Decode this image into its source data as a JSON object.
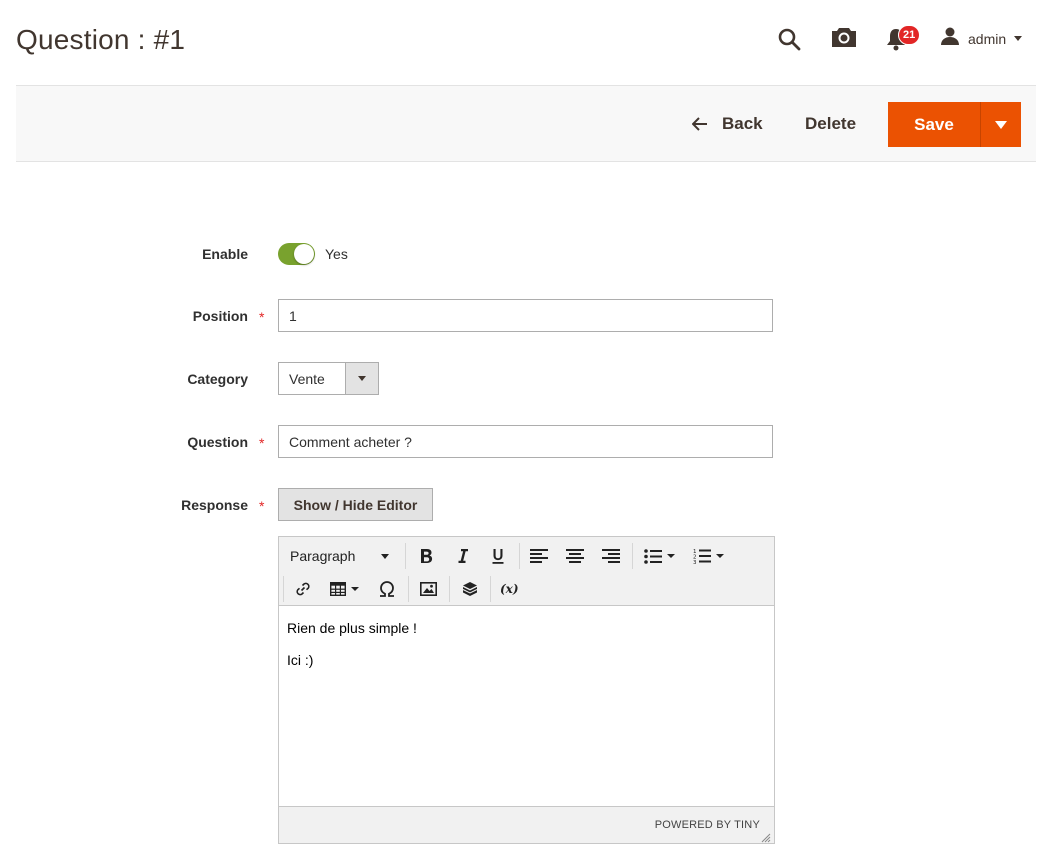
{
  "header": {
    "title": "Question : #1",
    "notifications_count": "21",
    "user_name": "admin",
    "icons": [
      "search-icon",
      "camera-icon",
      "bell-icon",
      "user-icon"
    ]
  },
  "actions": {
    "back_label": "Back",
    "delete_label": "Delete",
    "save_label": "Save"
  },
  "form": {
    "enable": {
      "label": "Enable",
      "value": "Yes",
      "checked": true
    },
    "position": {
      "label": "Position",
      "value": "1",
      "required": true
    },
    "category": {
      "label": "Category",
      "value": "Vente"
    },
    "question": {
      "label": "Question",
      "value": "Comment acheter ?",
      "required": true
    },
    "response": {
      "label": "Response",
      "required": true,
      "toggle_editor_label": "Show / Hide Editor"
    }
  },
  "editor": {
    "format_value": "Paragraph",
    "content": [
      "Rien de plus simple !",
      "Ici :)"
    ],
    "powered_by": "POWERED BY TINY"
  },
  "colors": {
    "accent": "#eb5202",
    "toggle_on": "#79a22e",
    "badge": "#e22626",
    "required": "#e22626"
  }
}
